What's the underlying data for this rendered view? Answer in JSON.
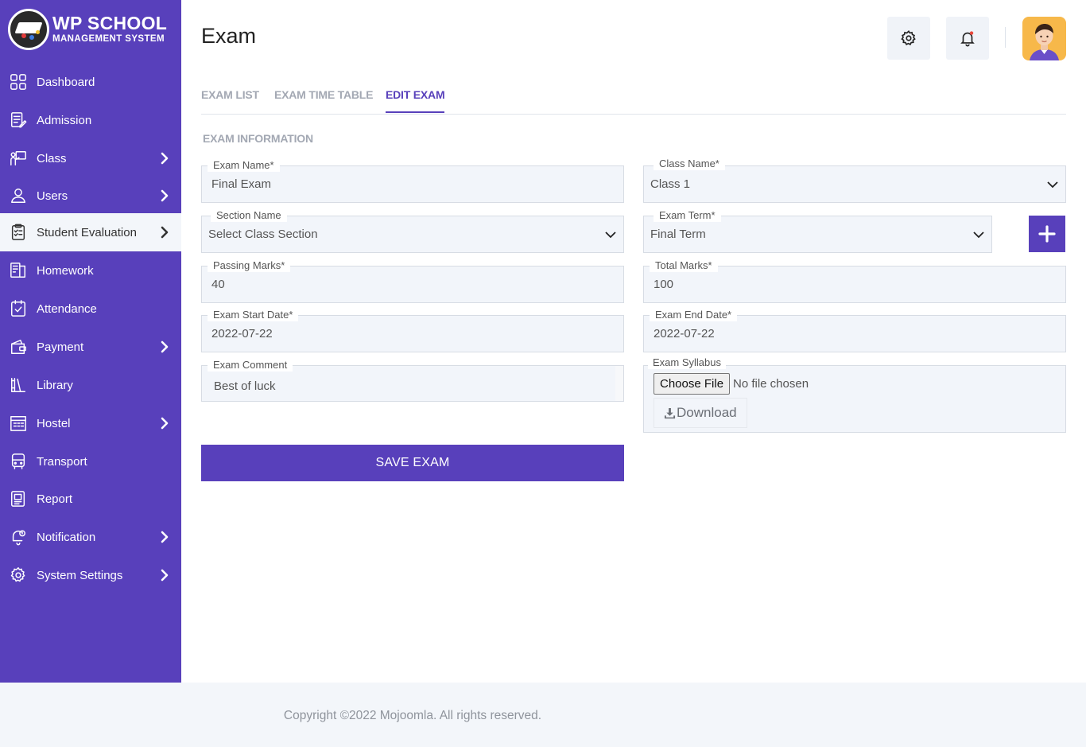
{
  "brand": {
    "title": "WP SCHOOL",
    "subtitle": "MANAGEMENT SYSTEM"
  },
  "sidebar": {
    "items": [
      {
        "label": "Dashboard",
        "icon": "dashboard-grid-icon",
        "chevron": false,
        "active": false
      },
      {
        "label": "Admission",
        "icon": "admission-form-icon",
        "chevron": false,
        "active": false
      },
      {
        "label": "Class",
        "icon": "class-teacher-icon",
        "chevron": true,
        "active": false
      },
      {
        "label": "Users",
        "icon": "user-icon",
        "chevron": true,
        "active": false
      },
      {
        "label": "Student Evaluation",
        "icon": "evaluation-clipboard-icon",
        "chevron": true,
        "active": true
      },
      {
        "label": "Homework",
        "icon": "homework-book-icon",
        "chevron": false,
        "active": false
      },
      {
        "label": "Attendance",
        "icon": "attendance-calendar-icon",
        "chevron": false,
        "active": false
      },
      {
        "label": "Payment",
        "icon": "payment-wallet-icon",
        "chevron": true,
        "active": false
      },
      {
        "label": "Library",
        "icon": "library-books-icon",
        "chevron": false,
        "active": false
      },
      {
        "label": "Hostel",
        "icon": "hostel-building-icon",
        "chevron": true,
        "active": false
      },
      {
        "label": "Transport",
        "icon": "transport-bus-icon",
        "chevron": false,
        "active": false
      },
      {
        "label": "Report",
        "icon": "report-document-icon",
        "chevron": false,
        "active": false
      },
      {
        "label": "Notification",
        "icon": "notification-bell-icon",
        "chevron": true,
        "active": false
      },
      {
        "label": "System Settings",
        "icon": "settings-gear-icon",
        "chevron": true,
        "active": false
      }
    ]
  },
  "header": {
    "title": "Exam"
  },
  "tabs": [
    {
      "label": "EXAM LIST"
    },
    {
      "label": "EXAM TIME TABLE"
    },
    {
      "label": "EDIT EXAM"
    }
  ],
  "form": {
    "section_title": "EXAM INFORMATION",
    "exam_name": {
      "label": "Exam Name*",
      "value": "Final Exam"
    },
    "class_name": {
      "label": "Class Name*",
      "value": "Class 1"
    },
    "section_name": {
      "label": "Section Name",
      "value": "Select Class Section"
    },
    "exam_term": {
      "label": "Exam Term*",
      "value": "Final Term"
    },
    "passing_marks": {
      "label": "Passing Marks*",
      "value": "40"
    },
    "total_marks": {
      "label": "Total Marks*",
      "value": "100"
    },
    "start_date": {
      "label": "Exam Start Date*",
      "value": "2022-07-22"
    },
    "end_date": {
      "label": "Exam End Date*",
      "value": "2022-07-22"
    },
    "comment": {
      "label": "Exam Comment",
      "value": "Best of luck"
    },
    "syllabus": {
      "label": "Exam Syllabus",
      "choose_label": "Choose File",
      "no_file": "No file chosen",
      "download_label": "Download"
    },
    "save_label": "SAVE EXAM"
  },
  "footer": {
    "text": "Copyright ©2022 Mojoomla. All rights reserved."
  },
  "colors": {
    "primary": "#5840bb",
    "field_bg": "#f2f5fa",
    "muted_text": "#a3a8b3"
  }
}
